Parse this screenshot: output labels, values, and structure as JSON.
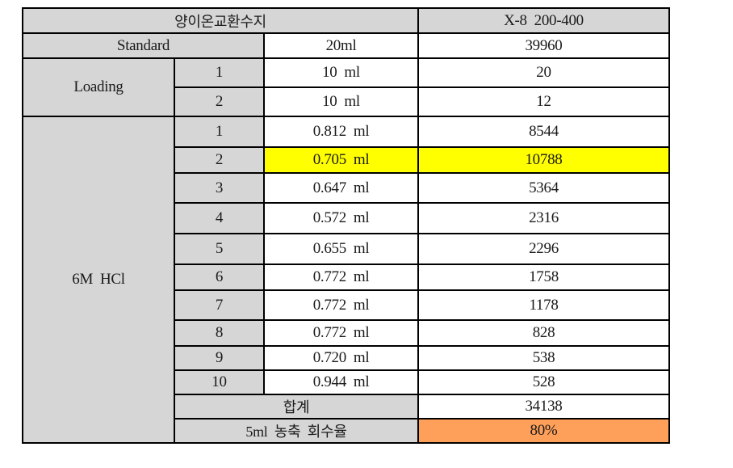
{
  "table": {
    "header": {
      "left": "양이온교환수지",
      "right": "X-8  200-400"
    },
    "standard": {
      "label": "Standard",
      "volume": "20ml",
      "value": "39960"
    },
    "loading": {
      "label": "Loading",
      "rows": [
        {
          "index": "1",
          "volume": "10  ml",
          "value": "20"
        },
        {
          "index": "2",
          "volume": "10  ml",
          "value": "12"
        }
      ]
    },
    "hcl": {
      "label": "6M  HCl",
      "rows": [
        {
          "index": "1",
          "volume": "0.812  ml",
          "value": "8544",
          "highlight": "none"
        },
        {
          "index": "2",
          "volume": "0.705  ml",
          "value": "10788",
          "highlight": "yellow"
        },
        {
          "index": "3",
          "volume": "0.647  ml",
          "value": "5364",
          "highlight": "none"
        },
        {
          "index": "4",
          "volume": "0.572  ml",
          "value": "2316",
          "highlight": "none"
        },
        {
          "index": "5",
          "volume": "0.655  ml",
          "value": "2296",
          "highlight": "none"
        },
        {
          "index": "6",
          "volume": "0.772  ml",
          "value": "1758",
          "highlight": "none"
        },
        {
          "index": "7",
          "volume": "0.772  ml",
          "value": "1178",
          "highlight": "none"
        },
        {
          "index": "8",
          "volume": "0.772  ml",
          "value": "828",
          "highlight": "none"
        },
        {
          "index": "9",
          "volume": "0.720  ml",
          "value": "538",
          "highlight": "none"
        },
        {
          "index": "10",
          "volume": "0.944  ml",
          "value": "528",
          "highlight": "none"
        }
      ],
      "total": {
        "label": "합계",
        "value": "34138"
      },
      "recovery": {
        "label": "5ml  농축  회수율",
        "value": "80%"
      }
    }
  },
  "colors": {
    "header_gray": "#d6d6d6",
    "highlight_yellow": "#ffff00",
    "highlight_orange": "#ffa05a",
    "border": "#000000"
  }
}
